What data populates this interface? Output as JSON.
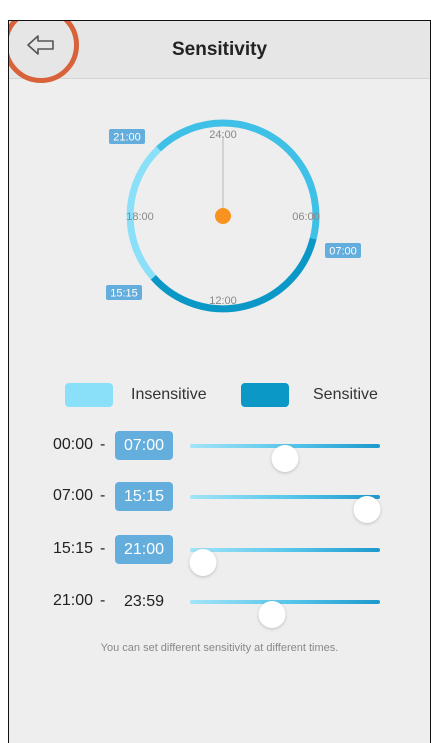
{
  "header": {
    "title": "Sensitivity",
    "back_icon": "arrow-left-outline-icon"
  },
  "dial": {
    "labels": {
      "top": "24:00",
      "right": "06:00",
      "bottom": "12:00",
      "left": "18:00"
    },
    "tags": [
      "21:00",
      "07:00",
      "15:15"
    ],
    "center_color": "#f7931e"
  },
  "legend": {
    "insensitive_label": "Insensitive",
    "insensitive_color": "#8ae0f8",
    "sensitive_label": "Sensitive",
    "sensitive_color": "#0b98c6"
  },
  "schedule": [
    {
      "start": "00:00",
      "end": "07:00",
      "end_editable": true,
      "sensitivity": 0.5
    },
    {
      "start": "07:00",
      "end": "15:15",
      "end_editable": true,
      "sensitivity": 0.93
    },
    {
      "start": "15:15",
      "end": "21:00",
      "end_editable": true,
      "sensitivity": 0.07
    },
    {
      "start": "21:00",
      "end": "23:59",
      "end_editable": false,
      "sensitivity": 0.43
    }
  ],
  "separator": "-",
  "hint": "You can set different sensitivity at different times."
}
